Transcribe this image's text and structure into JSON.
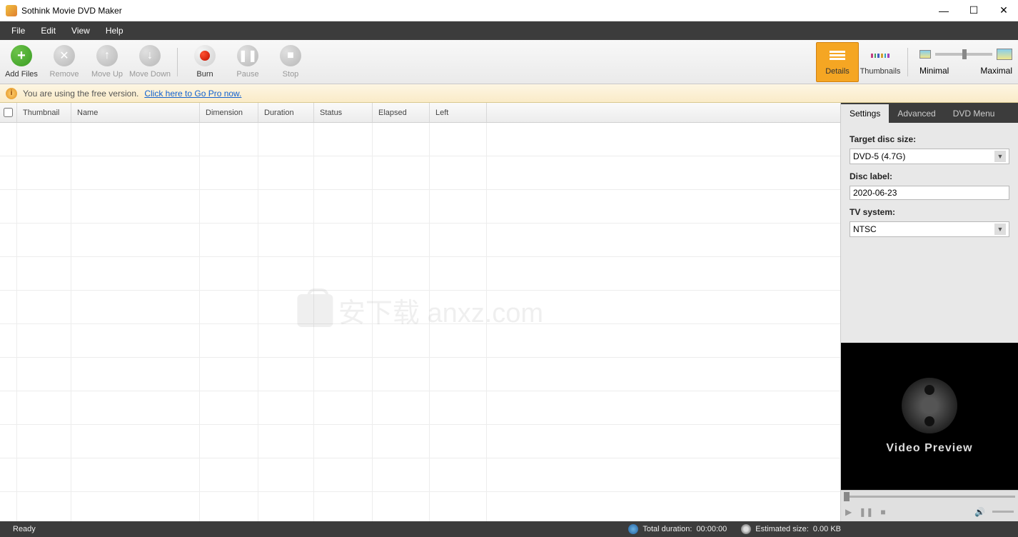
{
  "window": {
    "title": "Sothink Movie DVD Maker"
  },
  "menu": [
    "File",
    "Edit",
    "View",
    "Help"
  ],
  "toolbar": {
    "add_files": "Add Files",
    "remove": "Remove",
    "move_up": "Move Up",
    "move_down": "Move Down",
    "burn": "Burn",
    "pause": "Pause",
    "stop": "Stop",
    "view_details": "Details",
    "view_thumbnails": "Thumbnails",
    "view_minimal": "Minimal",
    "view_maximal": "Maximal"
  },
  "infobar": {
    "msg": "You are using the free version.",
    "link": "Click here to Go Pro now."
  },
  "table": {
    "headers": {
      "thumbnail": "Thumbnail",
      "name": "Name",
      "dimension": "Dimension",
      "duration": "Duration",
      "status": "Status",
      "elapsed": "Elapsed",
      "left": "Left"
    }
  },
  "side": {
    "tabs": [
      "Settings",
      "Advanced",
      "DVD Menu"
    ],
    "target_disc_label": "Target disc size:",
    "target_disc_value": "DVD-5 (4.7G)",
    "disc_label_label": "Disc label:",
    "disc_label_value": "2020-06-23",
    "tv_system_label": "TV system:",
    "tv_system_value": "NTSC"
  },
  "preview": {
    "label": "Video Preview"
  },
  "status": {
    "ready": "Ready",
    "total_duration_label": "Total duration:",
    "total_duration_value": "00:00:00",
    "estimated_size_label": "Estimated size:",
    "estimated_size_value": "0.00 KB"
  },
  "watermark": "安下载 anxz.com"
}
